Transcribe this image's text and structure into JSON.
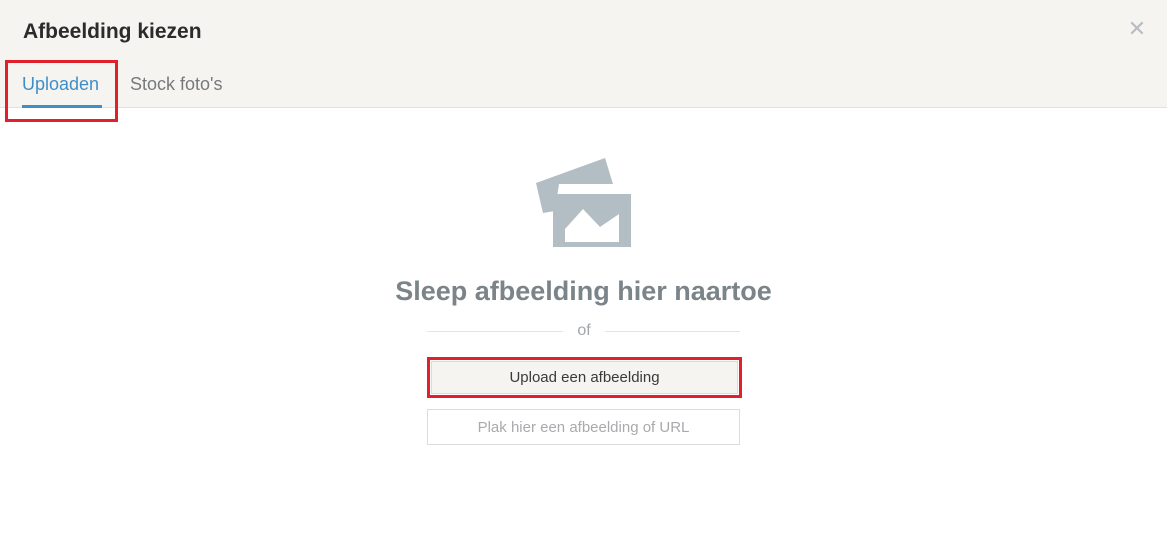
{
  "dialog": {
    "title": "Afbeelding kiezen",
    "close_icon": "close-icon"
  },
  "tabs": [
    {
      "label": "Uploaden",
      "active": true
    },
    {
      "label": "Stock foto's",
      "active": false
    }
  ],
  "upload": {
    "icon": "image-icon",
    "drop_text": "Sleep afbeelding hier naartoe",
    "divider_text": "of",
    "upload_button_label": "Upload een afbeelding",
    "url_placeholder": "Plak hier een afbeelding of URL"
  },
  "colors": {
    "accent": "#3f8fc6",
    "highlight": "#e0202b",
    "header_bg": "#f5f4f0",
    "icon": "#b3bdc4"
  }
}
